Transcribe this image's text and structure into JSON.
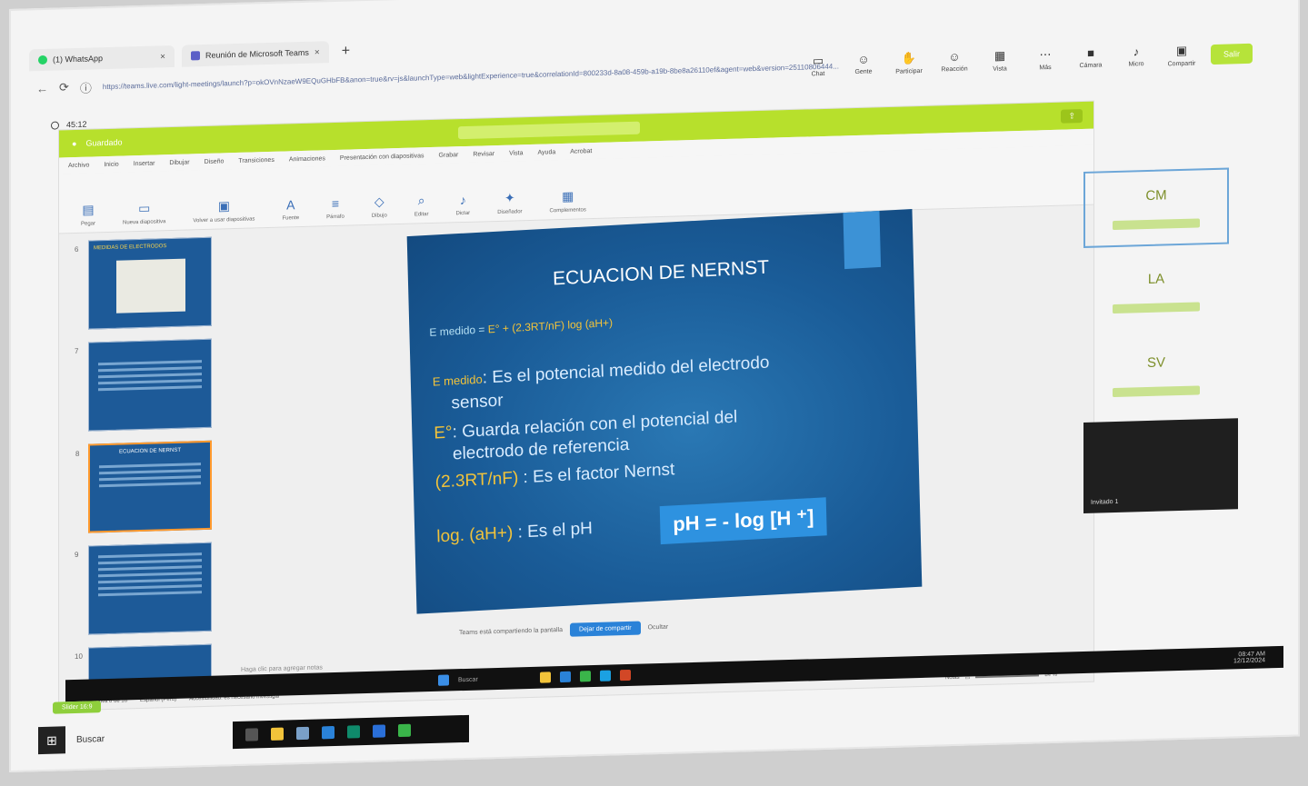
{
  "browser": {
    "tabs": [
      {
        "label": "(1) WhatsApp",
        "icon": "whatsapp-icon"
      },
      {
        "label": "Reunión de Microsoft Teams",
        "icon": "teams-icon"
      }
    ],
    "new_tab": "+",
    "url": "https://teams.live.com/light-meetings/launch?p=okOVnNzaeW9EQuGHbFB&anon=true&rv=js&launchType=web&lightExperience=true&correlationId=800233d-8a08-459b-a19b-8be8a26110ef&agent=web&version=25110806444...",
    "window_controls": [
      "-",
      "▫",
      "×"
    ]
  },
  "teams_toolbar": {
    "items": [
      {
        "label": "Chat",
        "icon": "chat-icon"
      },
      {
        "label": "Gente",
        "icon": "people-icon"
      },
      {
        "label": "Participar",
        "icon": "raise-hand-icon"
      },
      {
        "label": "Reacción",
        "icon": "reaction-icon"
      },
      {
        "label": "Vista",
        "icon": "view-icon"
      },
      {
        "label": "Más",
        "icon": "more-icon"
      },
      {
        "label": "Cámara",
        "icon": "camera-icon"
      },
      {
        "label": "Micro",
        "icon": "mic-icon"
      },
      {
        "label": "Compartir",
        "icon": "share-icon"
      }
    ],
    "leave": "Salir",
    "timer": "45:12"
  },
  "ppt": {
    "app_title": "Guardado",
    "menu": [
      "Archivo",
      "Inicio",
      "Insertar",
      "Dibujar",
      "Diseño",
      "Transiciones",
      "Animaciones",
      "Presentación con diapositivas",
      "Grabar",
      "Revisar",
      "Vista",
      "Ayuda",
      "Acrobat"
    ],
    "ribbon": [
      "Pegar",
      "Nueva diapositiva",
      "Volver a usar diapositivas",
      "Fuente",
      "Párrafo",
      "Dibujo",
      "Editar",
      "Dictar",
      "Diseñador",
      "Complementos"
    ],
    "thumbnails": [
      {
        "num": "6",
        "title": "MEDIDAS DE ELECTRODOS"
      },
      {
        "num": "7",
        "title": ""
      },
      {
        "num": "8",
        "title": "ECUACION DE NERNST"
      },
      {
        "num": "9",
        "title": ""
      },
      {
        "num": "10",
        "title": ""
      }
    ],
    "notes_placeholder": "Haga clic para agregar notas",
    "share_notice": "Teams está compartiendo la pantalla",
    "stop_share": "Dejar de compartir",
    "hide": "Ocultar",
    "status_left": "Diapositiva 8 de 16",
    "status_lang": "Español (Perú)",
    "status_access": "Accesibilidad: es necesario investigar",
    "notes_btn": "Notas",
    "zoom": "84 %"
  },
  "slide": {
    "title": "ECUACION DE NERNST",
    "formula_prefix": "E medido = ",
    "formula_body": "E° + (2.3RT/nF) log (aH+)",
    "b1_key": "E medido",
    "b1_text": ": Es el potencial medido del electrodo",
    "b1_cont": "sensor",
    "b2_key": "E°",
    "b2_text": ": Guarda relación con el potencial del",
    "b2_cont": "electrodo de referencia",
    "b3_key": "(2.3RT/nF)",
    "b3_text": " : Es el factor Nernst",
    "b4_key": "log. (aH+)",
    "b4_text": " : Es el pH",
    "ph_box": "pH = - log [H ⁺]"
  },
  "participants": [
    {
      "initials": "CM"
    },
    {
      "initials": "LA"
    },
    {
      "initials": "SV"
    },
    {
      "initials": "",
      "caption": "Invitado 1"
    }
  ],
  "remote_taskbar": {
    "search": "Buscar",
    "time": "08:47 AM",
    "date": "12/12/2024"
  },
  "local_taskbar": {
    "search": "Buscar",
    "chip": "Slider 16:9"
  },
  "colors": {
    "teams_green": "#b6e33a",
    "slide_blue": "#1a5c98",
    "slide_yellow": "#f2c33a",
    "ph_box": "#2e92e0"
  }
}
